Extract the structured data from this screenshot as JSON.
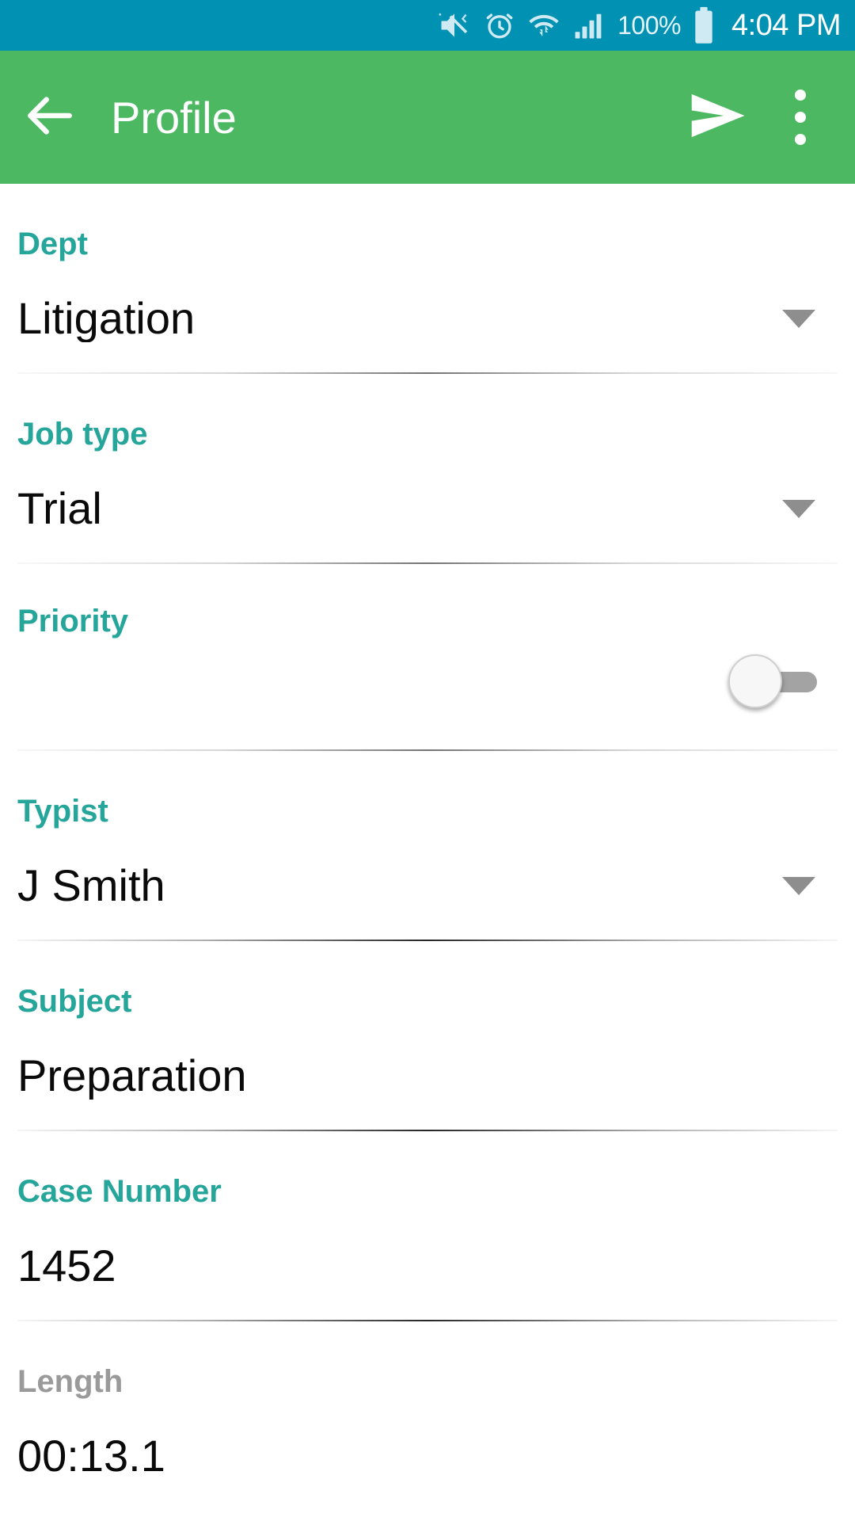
{
  "status_bar": {
    "background": "#0091b3",
    "battery_percent": "100%",
    "time": "4:04 PM",
    "icons": [
      "vibrate-mute-icon",
      "alarm-clock-icon",
      "wifi-icon",
      "cellular-signal-icon",
      "battery-full-icon"
    ]
  },
  "app_bar": {
    "background": "#4cb962",
    "title": "Profile",
    "back_icon": "arrow-left-icon",
    "send_icon": "send-icon",
    "overflow_icon": "more-vertical-icon"
  },
  "theme": {
    "label_color": "#26a69a",
    "value_color": "#0a0a0a",
    "disabled_label_color": "#9a9a9a",
    "accent_green": "#4cb962",
    "toggle_track_off": "#a3a3a3",
    "toggle_thumb": "#f7f7f7"
  },
  "form": {
    "fields": [
      {
        "name": "dept",
        "label": "Dept",
        "value": "Litigation",
        "control": "dropdown",
        "disabled": false
      },
      {
        "name": "job-type",
        "label": "Job type",
        "value": "Trial",
        "control": "dropdown",
        "disabled": false
      },
      {
        "name": "priority",
        "label": "Priority",
        "value": "",
        "control": "toggle",
        "toggle_state": "off",
        "disabled": false
      },
      {
        "name": "typist",
        "label": "Typist",
        "value": "J Smith",
        "control": "dropdown",
        "disabled": false
      },
      {
        "name": "subject",
        "label": "Subject",
        "value": "Preparation",
        "control": "text",
        "disabled": false
      },
      {
        "name": "case-number",
        "label": "Case Number",
        "value": "1452",
        "control": "text",
        "disabled": false
      },
      {
        "name": "length",
        "label": "Length",
        "value": "00:13.1",
        "control": "readonly",
        "disabled": true
      }
    ]
  }
}
